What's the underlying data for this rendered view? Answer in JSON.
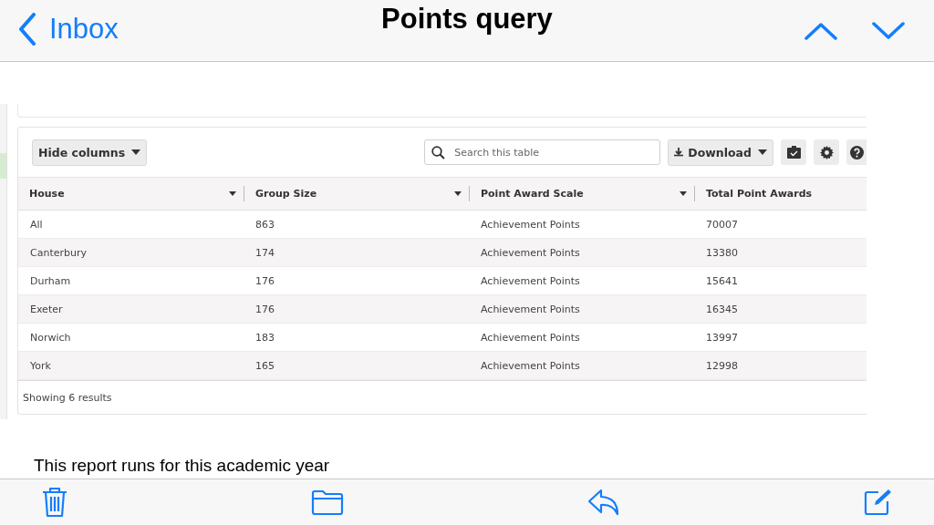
{
  "nav_bar": {
    "back_label": "Inbox",
    "title": "Points query"
  },
  "report": {
    "hide_columns_label": "Hide columns",
    "search": {
      "placeholder": "Search this table"
    },
    "download_label": "Download",
    "columns": [
      "House",
      "Group Size",
      "Point Award Scale",
      "Total Point Awards"
    ],
    "rows": [
      [
        "All",
        "863",
        "Achievement Points",
        "70007"
      ],
      [
        "Canterbury",
        "174",
        "Achievement Points",
        "13380"
      ],
      [
        "Durham",
        "176",
        "Achievement Points",
        "15641"
      ],
      [
        "Exeter",
        "176",
        "Achievement Points",
        "16345"
      ],
      [
        "Norwich",
        "183",
        "Achievement Points",
        "13997"
      ],
      [
        "York",
        "165",
        "Achievement Points",
        "12998"
      ]
    ],
    "footer": "Showing 6 results"
  },
  "body_text": "This report runs for this academic year"
}
